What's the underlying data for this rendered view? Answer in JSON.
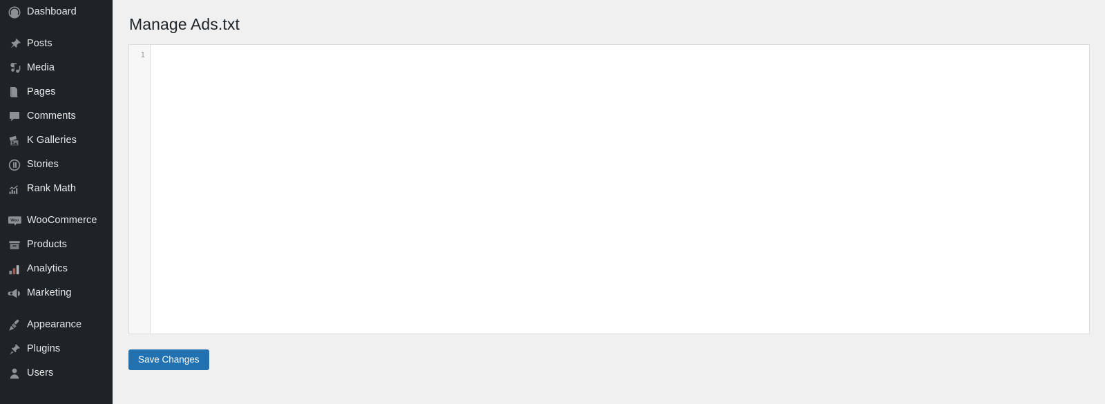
{
  "sidebar": {
    "items": [
      {
        "label": "Dashboard",
        "icon": "dashboard-gauge-icon",
        "name": "sidebar-item-dashboard",
        "sep_after": true
      },
      {
        "label": "Posts",
        "icon": "pin-icon",
        "name": "sidebar-item-posts",
        "sep_after": false
      },
      {
        "label": "Media",
        "icon": "media-icon",
        "name": "sidebar-item-media",
        "sep_after": false
      },
      {
        "label": "Pages",
        "icon": "pages-icon",
        "name": "sidebar-item-pages",
        "sep_after": false
      },
      {
        "label": "Comments",
        "icon": "comment-bubble-icon",
        "name": "sidebar-item-comments",
        "sep_after": false
      },
      {
        "label": "K Galleries",
        "icon": "gallery-images-icon",
        "name": "sidebar-item-k-galleries",
        "sep_after": false
      },
      {
        "label": "Stories",
        "icon": "stories-circle-icon",
        "name": "sidebar-item-stories",
        "sep_after": false
      },
      {
        "label": "Rank Math",
        "icon": "rank-math-icon",
        "name": "sidebar-item-rank-math",
        "sep_after": true
      },
      {
        "label": "WooCommerce",
        "icon": "woocommerce-icon",
        "name": "sidebar-item-woocommerce",
        "sep_after": false
      },
      {
        "label": "Products",
        "icon": "products-box-icon",
        "name": "sidebar-item-products",
        "sep_after": false
      },
      {
        "label": "Analytics",
        "icon": "bar-chart-icon",
        "name": "sidebar-item-analytics",
        "sep_after": false
      },
      {
        "label": "Marketing",
        "icon": "megaphone-icon",
        "name": "sidebar-item-marketing",
        "sep_after": true
      },
      {
        "label": "Appearance",
        "icon": "paintbrush-icon",
        "name": "sidebar-item-appearance",
        "sep_after": false
      },
      {
        "label": "Plugins",
        "icon": "plug-icon",
        "name": "sidebar-item-plugins",
        "sep_after": false
      },
      {
        "label": "Users",
        "icon": "user-icon",
        "name": "sidebar-item-users",
        "sep_after": false
      }
    ]
  },
  "main": {
    "page_title": "Manage Ads.txt",
    "editor": {
      "line_numbers": [
        "1"
      ],
      "content": "",
      "placeholder": ""
    },
    "save_button_label": "Save Changes"
  },
  "colors": {
    "sidebar_bg": "#1d2327",
    "sidebar_text": "#eaeaea",
    "content_bg": "#f0f0f1",
    "editor_bg": "#ffffff",
    "editor_border": "#dcdcde",
    "gutter_bg": "#f7f7f7",
    "primary_button": "#2271b1",
    "title_text": "#1d2327"
  }
}
